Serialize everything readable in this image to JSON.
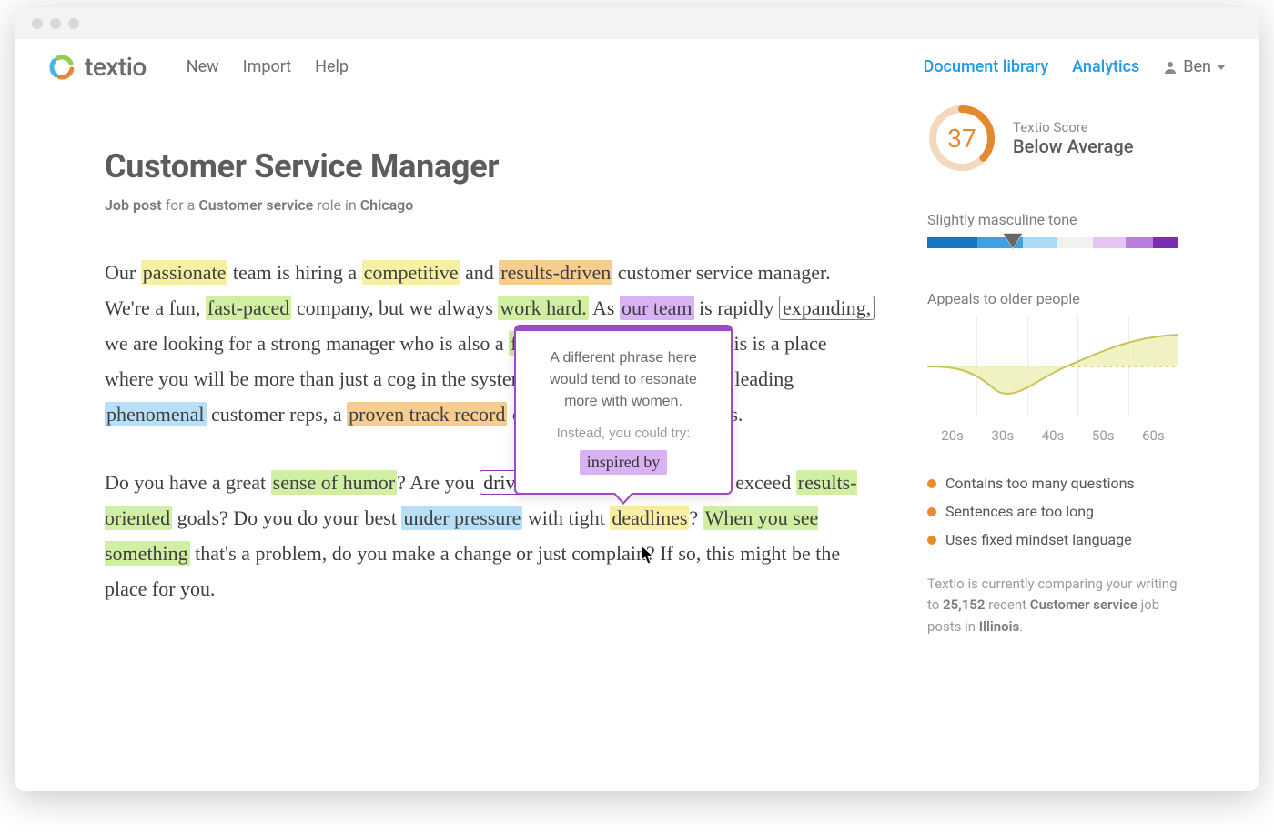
{
  "nav": {
    "brand": "textio",
    "items": [
      "New",
      "Import",
      "Help"
    ],
    "right_links": [
      "Document library",
      "Analytics"
    ],
    "user": "Ben"
  },
  "doc": {
    "title": "Customer Service Manager",
    "meta_prefix": "Job post",
    "meta_mid": " for a ",
    "meta_role": "Customer service",
    "meta_roleword": " role in ",
    "meta_location": "Chicago",
    "p1": {
      "t0": "Our ",
      "w_passionate": "passionate",
      "t1": " team is hiring a ",
      "w_competitive": "competitive",
      "t2": " and ",
      "w_resultsdriven": "results-driven",
      "t3": " customer service manager. We're a fun, ",
      "w_fastpaced": "fast-paced",
      "t4": " company, but we always ",
      "w_workhard": "work hard.",
      "t5": " As ",
      "w_ourteam": "our team",
      "t6": " is rapidly ",
      "w_expanding": "expanding,",
      "t7": " we are looking for a strong manager who is also a ",
      "w_forward": "forward-thinking",
      "t8": " leader. This is a place where you will be more than just a cog in the system. We are passionate about leading ",
      "w_phenomenal": "phenomenal",
      "t9": " customer reps, a ",
      "w_proventrack": "proven track record",
      "t10": " of this would be a huge plus."
    },
    "p2": {
      "t0": "Do you have a great ",
      "w_humor": "sense of humor",
      "t1": "? Are you ",
      "w_drivenby": "driven by",
      "t2": " the ability to set and exceed ",
      "w_resultsoriented": "results-oriented",
      "t3": " goals? Do you do your best ",
      "w_underpressure": "under pressure",
      "t4": " with tight ",
      "w_deadlines": "deadlines",
      "t5": "? ",
      "w_whenyousee": "When you see something",
      "t6": " that's a problem, do you make a change or just complain? If so, this might be the place for you."
    }
  },
  "tooltip": {
    "body": "A different phrase here would tend to resonate more with women.",
    "sub": "Instead, you could try:",
    "suggestion": "inspired by"
  },
  "score": {
    "value": "37",
    "label_small": "Textio Score",
    "label_big": "Below Average"
  },
  "tone": {
    "label": "Slightly masculine tone",
    "segments": [
      {
        "color": "#1776c4",
        "w": 20
      },
      {
        "color": "#3ea0e5",
        "w": 18
      },
      {
        "color": "#a9daf6",
        "w": 14
      },
      {
        "color": "#f1f1f1",
        "w": 14
      },
      {
        "color": "#e5c4f3",
        "w": 13
      },
      {
        "color": "#b77ede",
        "w": 11
      },
      {
        "color": "#7a2db2",
        "w": 10
      }
    ],
    "marker_left_pct": 34
  },
  "age": {
    "label": "Appeals to older people",
    "labels": [
      "20s",
      "30s",
      "40s",
      "50s",
      "60s"
    ]
  },
  "issues": [
    "Contains too many questions",
    "Sentences are too long",
    "Uses fixed mindset language"
  ],
  "footer": {
    "t0": "Textio is currently comparing your writing to ",
    "count": "25,152",
    "t1": " recent ",
    "role": "Customer service",
    "t2": " job posts in ",
    "loc": "Illinois",
    "t3": "."
  }
}
